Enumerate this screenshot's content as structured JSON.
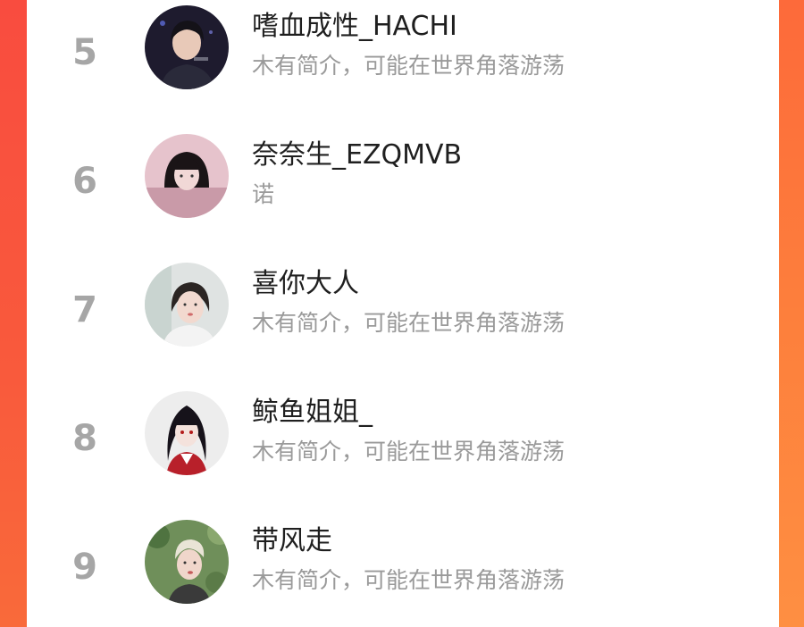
{
  "ranking": {
    "items": [
      {
        "rank": "5",
        "name": "嗜血成性_HACHI",
        "bio": "木有简介，可能在世界角落游荡",
        "avatar": "dark-hair-person-avatar"
      },
      {
        "rank": "6",
        "name": "奈奈生_EZQMVB",
        "bio": "诺",
        "avatar": "bob-hair-girl-avatar"
      },
      {
        "rank": "7",
        "name": "喜你大人",
        "bio": "木有简介，可能在世界角落游荡",
        "avatar": "selfie-girl-avatar"
      },
      {
        "rank": "8",
        "name": "鲸鱼姐姐_",
        "bio": "木有简介，可能在世界角落游荡",
        "avatar": "anime-girl-avatar"
      },
      {
        "rank": "9",
        "name": "带风走",
        "bio": "木有简介，可能在世界角落游荡",
        "avatar": "blonde-person-avatar"
      }
    ]
  },
  "colors": {
    "background_gradient_start": "#fb4d3e",
    "background_gradient_end": "#fe8f42",
    "rank_color": "#a6a6a6",
    "name_color": "#1f1f1f",
    "bio_color": "#9a9a9a"
  }
}
